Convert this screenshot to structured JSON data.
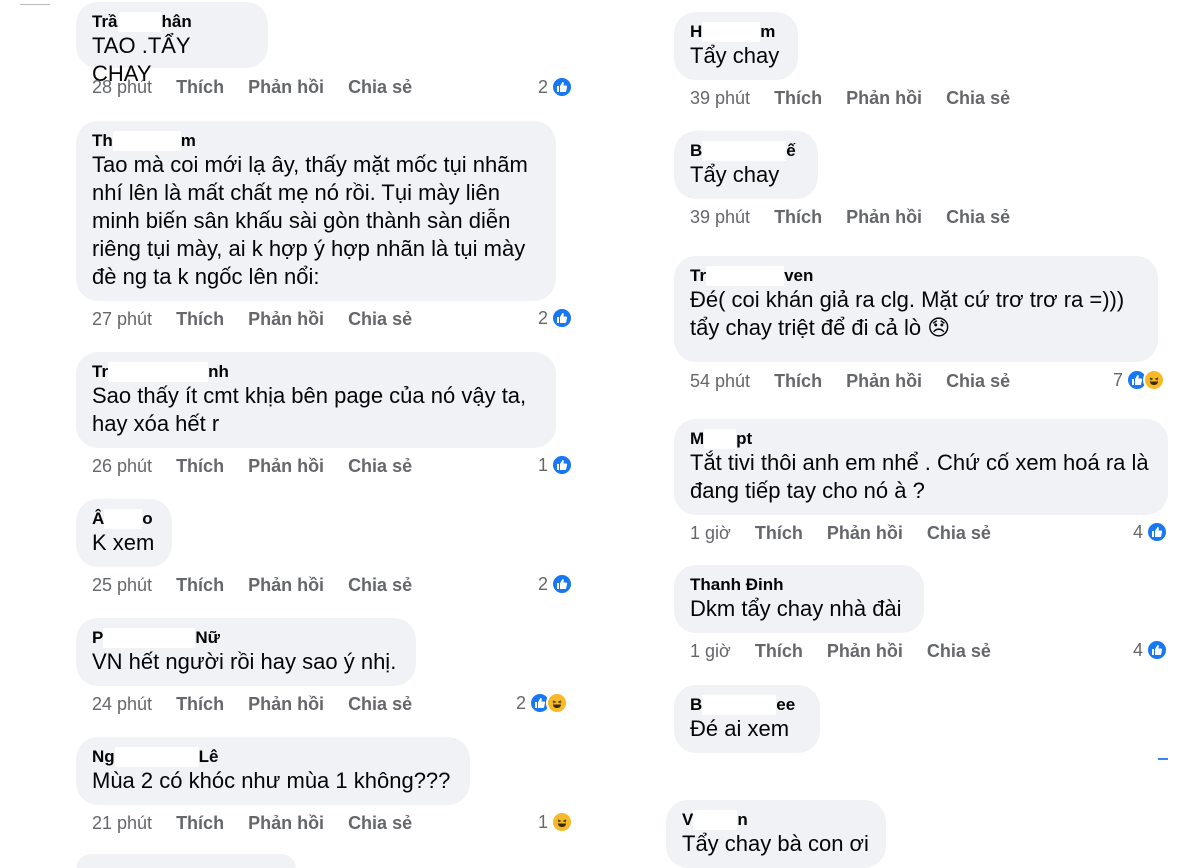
{
  "actions": {
    "like": "Thích",
    "reply": "Phản hồi",
    "share": "Chia sẻ"
  },
  "left": [
    {
      "author": "Trầ",
      "author_end": "hân",
      "text": [
        "TAO .TẨY CHAY"
      ],
      "time": "28 phút",
      "reactions": "2",
      "icons": [
        "like"
      ]
    },
    {
      "author": "Th",
      "author_end": "m",
      "text": [
        "Tao mà coi mới lạ ây, thấy mặt mốc tụi nhãm",
        "nhí lên là mất chất mẹ nó rồi. Tụi mày liên",
        "minh biến sân khấu sài gòn thành sàn diễn",
        "riêng tụi mày, ai k hợp ý hợp nhãn là tụi mày",
        "đè ng ta k ngốc lên nổi:"
      ],
      "time": "27 phút",
      "reactions": "2",
      "icons": [
        "like"
      ]
    },
    {
      "author": "Tr",
      "author_end": "nh",
      "text": [
        "Sao thấy ít cmt khịa bên page của nó vậy ta,",
        "hay xóa hết r"
      ],
      "time": "26 phút",
      "reactions": "1",
      "icons": [
        "like"
      ]
    },
    {
      "author": "Â",
      "author_end": "o",
      "text": [
        "K xem"
      ],
      "time": "25 phút",
      "reactions": "2",
      "icons": [
        "like"
      ]
    },
    {
      "author": "P",
      "author_end": "Nữ",
      "text": [
        "VN hết người rồi hay sao ý nhị."
      ],
      "time": "24 phút",
      "reactions": "2",
      "icons": [
        "like",
        "haha"
      ]
    },
    {
      "author": "Ng",
      "author_end": "Lê",
      "text": [
        "Mùa 2 có khóc như mùa 1 không???"
      ],
      "time": "21 phút",
      "reactions": "1",
      "icons": [
        "haha"
      ]
    }
  ],
  "right": [
    {
      "author": "H",
      "author_end": "m",
      "text": [
        "Tẩy chay"
      ],
      "time": "39 phút",
      "reactions": "",
      "icons": []
    },
    {
      "author": "B",
      "author_end": "ế",
      "text": [
        "Tẩy chay"
      ],
      "time": "39 phút",
      "reactions": "",
      "icons": []
    },
    {
      "author": "Tr",
      "author_end": "ven",
      "text": [
        "Đé( coi khán giả ra clg. Mặt cứ trơ trơ ra =)))",
        "tẩy chay triệt để đi cả lò 😞"
      ],
      "time": "54 phút",
      "reactions": "7",
      "icons": [
        "like",
        "haha"
      ]
    },
    {
      "author": "M",
      "author_end": "pt",
      "text": [
        "Tắt tivi thôi anh em nhể . Chứ cố xem hoá ra là",
        "đang tiếp tay cho nó à ?"
      ],
      "time": "1 giờ",
      "reactions": "4",
      "icons": [
        "like"
      ]
    },
    {
      "author": "Thanh Đinh",
      "author_end": "",
      "text": [
        "Dkm tẩy chay nhà đài"
      ],
      "time": "1 giờ",
      "reactions": "4",
      "icons": [
        "like"
      ]
    },
    {
      "author": "B",
      "author_end": "ee",
      "text": [
        "Đé ai xem"
      ],
      "time": "",
      "reactions": "",
      "icons": []
    },
    {
      "author": "V",
      "author_end": "n",
      "text": [
        "Tẩy chay bà con ơi"
      ],
      "time": "",
      "reactions": "",
      "icons": []
    }
  ]
}
